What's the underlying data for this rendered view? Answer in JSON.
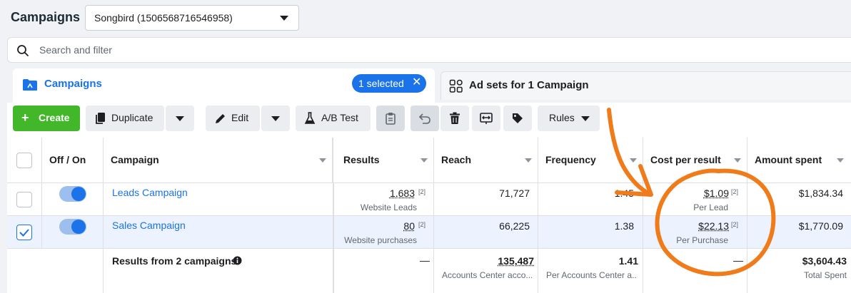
{
  "header": {
    "title": "Campaigns",
    "account": "Songbird (1506568716546958)"
  },
  "search": {
    "placeholder": "Search and filter"
  },
  "tabs": {
    "campaigns": "Campaigns",
    "selected": "1 selected",
    "adsets": "Ad sets for 1 Campaign"
  },
  "toolbar": {
    "create": "Create",
    "duplicate": "Duplicate",
    "edit": "Edit",
    "ab_test": "A/B Test",
    "rules": "Rules"
  },
  "columns": [
    "Off / On",
    "Campaign",
    "Results",
    "Reach",
    "Frequency",
    "Cost per result",
    "Amount spent"
  ],
  "rows": [
    {
      "checked": false,
      "on": true,
      "name": "Leads Campaign",
      "results": "1,683",
      "results_note": "[2]",
      "results_sub": "Website Leads",
      "reach": "71,727",
      "frequency": "1.45",
      "cost": "$1.09",
      "cost_note": "[2]",
      "cost_sub": "Per Lead",
      "spent": "$1,834.34"
    },
    {
      "checked": true,
      "on": true,
      "name": "Sales Campaign",
      "results": "80",
      "results_note": "[2]",
      "results_sub": "Website purchases",
      "reach": "66,225",
      "frequency": "1.38",
      "cost": "$22.13",
      "cost_note": "[2]",
      "cost_sub": "Per Purchase",
      "spent": "$1,770.09"
    }
  ],
  "totals": {
    "label": "Results from 2 campaigns",
    "results": "—",
    "reach": "135,487",
    "reach_sub": "Accounts Center acco...",
    "frequency": "1.41",
    "frequency_sub": "Per Accounts Center a...",
    "cost": "—",
    "spent": "$3,604.43",
    "spent_sub": "Total Spent"
  },
  "annotation_color": "#f07b1a"
}
